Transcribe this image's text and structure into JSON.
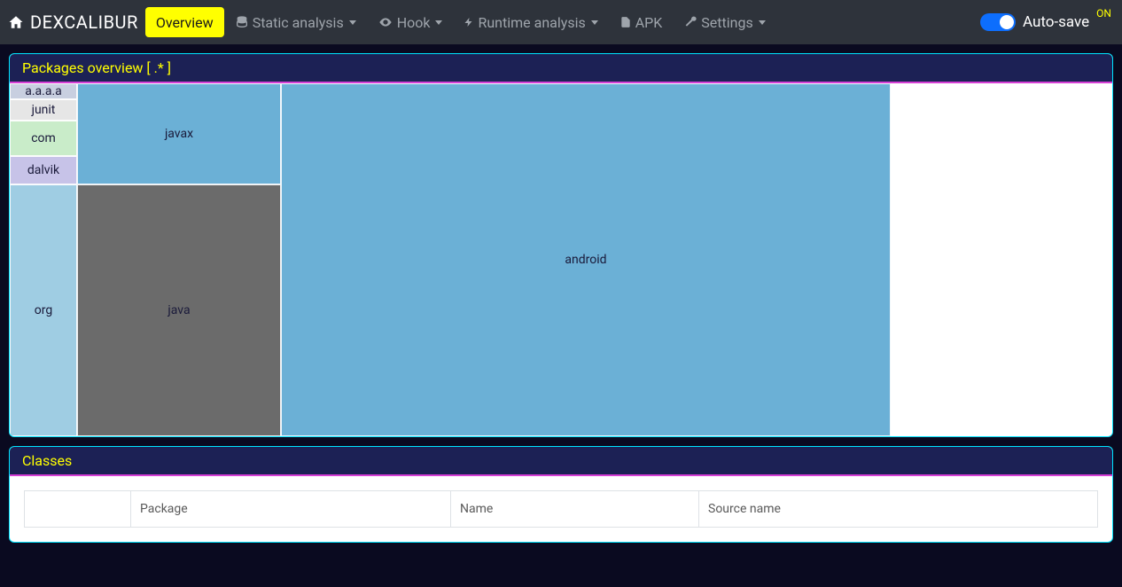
{
  "brand": "DEXCALIBUR",
  "nav": {
    "overview": "Overview",
    "static": "Static analysis",
    "hook": "Hook",
    "runtime": "Runtime analysis",
    "apk": "APK",
    "settings": "Settings"
  },
  "autosave": {
    "label": "Auto-save",
    "state": "ON"
  },
  "panels": {
    "packages_title": "Packages overview  [ .* ]",
    "classes_title": "Classes"
  },
  "chart_data": {
    "type": "treemap",
    "title": "Packages overview  [ .* ]",
    "items": [
      {
        "name": "android",
        "value": 2740,
        "color": "#6bb0d6"
      },
      {
        "name": "java",
        "value": 920,
        "color": "#6b6b6b"
      },
      {
        "name": "javax",
        "value": 360,
        "color": "#6bb0d6"
      },
      {
        "name": "org",
        "value": 320,
        "color": "#9fcde3"
      },
      {
        "name": "dalvik",
        "value": 40,
        "color": "#c7c3e8"
      },
      {
        "name": "com",
        "value": 36,
        "color": "#c9ecc9"
      },
      {
        "name": "junit",
        "value": 30,
        "color": "#e6e6e6"
      },
      {
        "name": "a.a.a.a",
        "value": 15,
        "color": "#c8cfe0"
      }
    ]
  },
  "table": {
    "columns": [
      "",
      "Package",
      "Name",
      "Source name"
    ],
    "rows": []
  }
}
